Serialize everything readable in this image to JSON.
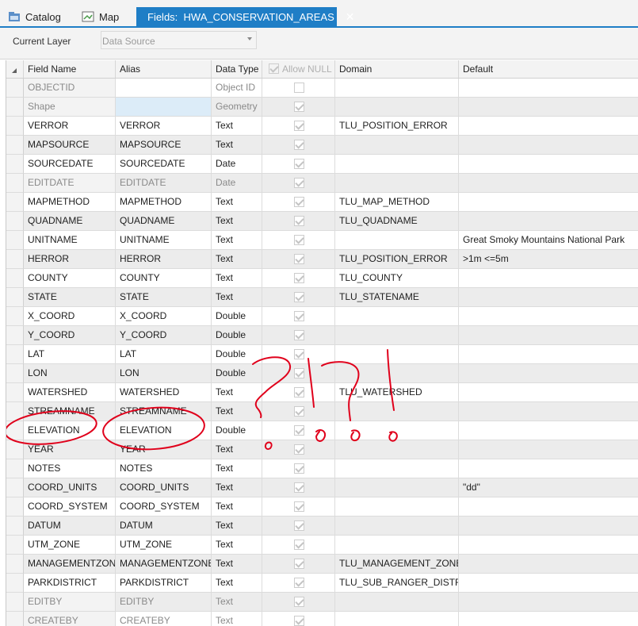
{
  "tabs": [
    {
      "label": "Catalog",
      "icon": "catalog-icon",
      "active": false
    },
    {
      "label": "Map",
      "icon": "map-icon",
      "active": false
    },
    {
      "label": "Fields:  HWA_CONSERVATION_AREAS",
      "icon": "fields-table-icon",
      "active": true
    }
  ],
  "close_glyph": "✕",
  "layer": {
    "label": "Current Layer",
    "value": "Data Source"
  },
  "columns": {
    "field_name": "Field Name",
    "alias": "Alias",
    "data_type": "Data Type",
    "allow_null": "Allow NULL",
    "domain": "Domain",
    "default": "Default"
  },
  "rows": [
    {
      "name": "OBJECTID",
      "alias": "",
      "type": "Object ID",
      "allow_null": false,
      "domain": "",
      "default": "",
      "readonly": true
    },
    {
      "name": "Shape",
      "alias": "",
      "type": "Geometry",
      "allow_null": true,
      "domain": "",
      "default": "",
      "readonly": true
    },
    {
      "name": "VERROR",
      "alias": "VERROR",
      "type": "Text",
      "allow_null": true,
      "domain": "TLU_POSITION_ERROR",
      "default": ""
    },
    {
      "name": "MAPSOURCE",
      "alias": "MAPSOURCE",
      "type": "Text",
      "allow_null": true,
      "domain": "",
      "default": ""
    },
    {
      "name": "SOURCEDATE",
      "alias": "SOURCEDATE",
      "type": "Date",
      "allow_null": true,
      "domain": "",
      "default": ""
    },
    {
      "name": "EDITDATE",
      "alias": "EDITDATE",
      "type": "Date",
      "allow_null": true,
      "domain": "",
      "default": "",
      "readonly": true
    },
    {
      "name": "MAPMETHOD",
      "alias": "MAPMETHOD",
      "type": "Text",
      "allow_null": true,
      "domain": "TLU_MAP_METHOD",
      "default": ""
    },
    {
      "name": "QUADNAME",
      "alias": "QUADNAME",
      "type": "Text",
      "allow_null": true,
      "domain": "TLU_QUADNAME",
      "default": ""
    },
    {
      "name": "UNITNAME",
      "alias": "UNITNAME",
      "type": "Text",
      "allow_null": true,
      "domain": "",
      "default": "Great Smoky Mountains National Park"
    },
    {
      "name": "HERROR",
      "alias": "HERROR",
      "type": "Text",
      "allow_null": true,
      "domain": "TLU_POSITION_ERROR",
      "default": ">1m <=5m"
    },
    {
      "name": "COUNTY",
      "alias": "COUNTY",
      "type": "Text",
      "allow_null": true,
      "domain": "TLU_COUNTY",
      "default": ""
    },
    {
      "name": "STATE",
      "alias": "STATE",
      "type": "Text",
      "allow_null": true,
      "domain": "TLU_STATENAME",
      "default": ""
    },
    {
      "name": "X_COORD",
      "alias": "X_COORD",
      "type": "Double",
      "allow_null": true,
      "domain": "",
      "default": ""
    },
    {
      "name": "Y_COORD",
      "alias": "Y_COORD",
      "type": "Double",
      "allow_null": true,
      "domain": "",
      "default": ""
    },
    {
      "name": "LAT",
      "alias": "LAT",
      "type": "Double",
      "allow_null": true,
      "domain": "",
      "default": ""
    },
    {
      "name": "LON",
      "alias": "LON",
      "type": "Double",
      "allow_null": true,
      "domain": "",
      "default": ""
    },
    {
      "name": "WATERSHED",
      "alias": "WATERSHED",
      "type": "Text",
      "allow_null": true,
      "domain": "TLU_WATERSHED",
      "default": ""
    },
    {
      "name": "STREAMNAME",
      "alias": "STREAMNAME",
      "type": "Text",
      "allow_null": true,
      "domain": "",
      "default": ""
    },
    {
      "name": "ELEVATION",
      "alias": "ELEVATION",
      "type": "Double",
      "allow_null": true,
      "domain": "",
      "default": ""
    },
    {
      "name": "YEAR",
      "alias": "YEAR",
      "type": "Text",
      "allow_null": true,
      "domain": "",
      "default": ""
    },
    {
      "name": "NOTES",
      "alias": "NOTES",
      "type": "Text",
      "allow_null": true,
      "domain": "",
      "default": ""
    },
    {
      "name": "COORD_UNITS",
      "alias": "COORD_UNITS",
      "type": "Text",
      "allow_null": true,
      "domain": "",
      "default": "\"dd\""
    },
    {
      "name": "COORD_SYSTEM",
      "alias": "COORD_SYSTEM",
      "type": "Text",
      "allow_null": true,
      "domain": "",
      "default": ""
    },
    {
      "name": "DATUM",
      "alias": "DATUM",
      "type": "Text",
      "allow_null": true,
      "domain": "",
      "default": ""
    },
    {
      "name": "UTM_ZONE",
      "alias": "UTM_ZONE",
      "type": "Text",
      "allow_null": true,
      "domain": "",
      "default": ""
    },
    {
      "name": "MANAGEMENTZONE",
      "alias": "MANAGEMENTZONE",
      "type": "Text",
      "allow_null": true,
      "domain": "TLU_MANAGEMENT_ZONE",
      "default": ""
    },
    {
      "name": "PARKDISTRICT",
      "alias": "PARKDISTRICT",
      "type": "Text",
      "allow_null": true,
      "domain": "TLU_SUB_RANGER_DISTRICT",
      "default": ""
    },
    {
      "name": "EDITBY",
      "alias": "EDITBY",
      "type": "Text",
      "allow_null": true,
      "domain": "",
      "default": "",
      "readonly": true
    },
    {
      "name": "CREATEBY",
      "alias": "CREATEBY",
      "type": "Text",
      "allow_null": true,
      "domain": "",
      "default": "",
      "readonly": true
    }
  ],
  "annotation_glyphs": [
    "?",
    "!",
    "?",
    "!"
  ],
  "colors": {
    "accent": "#1f7ec6",
    "ink": "#e0001b",
    "alt_row": "#ececec",
    "header_bg": "#f3f3f3",
    "shape_alias_cell": "#dcecf8"
  }
}
